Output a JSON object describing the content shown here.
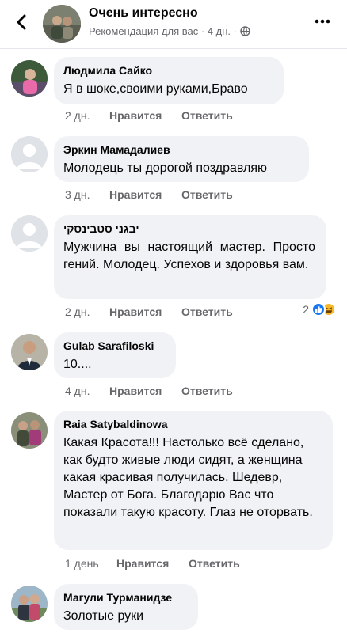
{
  "header": {
    "title": "Очень интересно",
    "subtitle": "Рекомендация для вас · 4 дн. ·",
    "icons": {
      "back": "chevron-left-icon",
      "globe": "globe-icon",
      "more": "more-dots-icon"
    }
  },
  "actions": {
    "like_label": "Нравится",
    "reply_label": "Ответить"
  },
  "comments": [
    {
      "author": "Людмила Сайко",
      "text": "Я в шоке,своими руками,Браво",
      "time": "2 дн."
    },
    {
      "author": "Эркин Мамадалиев",
      "text": "Молодець ты  дорогой поздравляю",
      "time": "3 дн."
    },
    {
      "author": "יבגני סטבינסקי",
      "text": "Мужчина  вы  настоящий  мастер. Просто   гений.  Молодец.  Успехов  и здоровья  вам.",
      "time": "2 дн.",
      "reaction_count": "2",
      "reaction_icons": [
        "like-reaction-icon",
        "haha-reaction-icon"
      ]
    },
    {
      "author": "Gulab Sarafiloski",
      "text": "10....",
      "time": "4 дн."
    },
    {
      "author": "Raia Satybaldinowa",
      "text": "Какая Красота!!! Настолько  всё сделано, как будто живые люди сидят, а женщина какая красивая получилась. Шедевр, Мастер от Бога. Благодарю  Вас что показали  такую красоту. Глаз не оторвать.",
      "time": "1 день"
    },
    {
      "author": "Магули Турманидзе",
      "text": "Золотые руки"
    }
  ],
  "colors": {
    "bubble": "#f0f2f5",
    "secondary_text": "#65676b",
    "like_blue": "#1877f2",
    "haha_yellow": "#f7b928"
  }
}
